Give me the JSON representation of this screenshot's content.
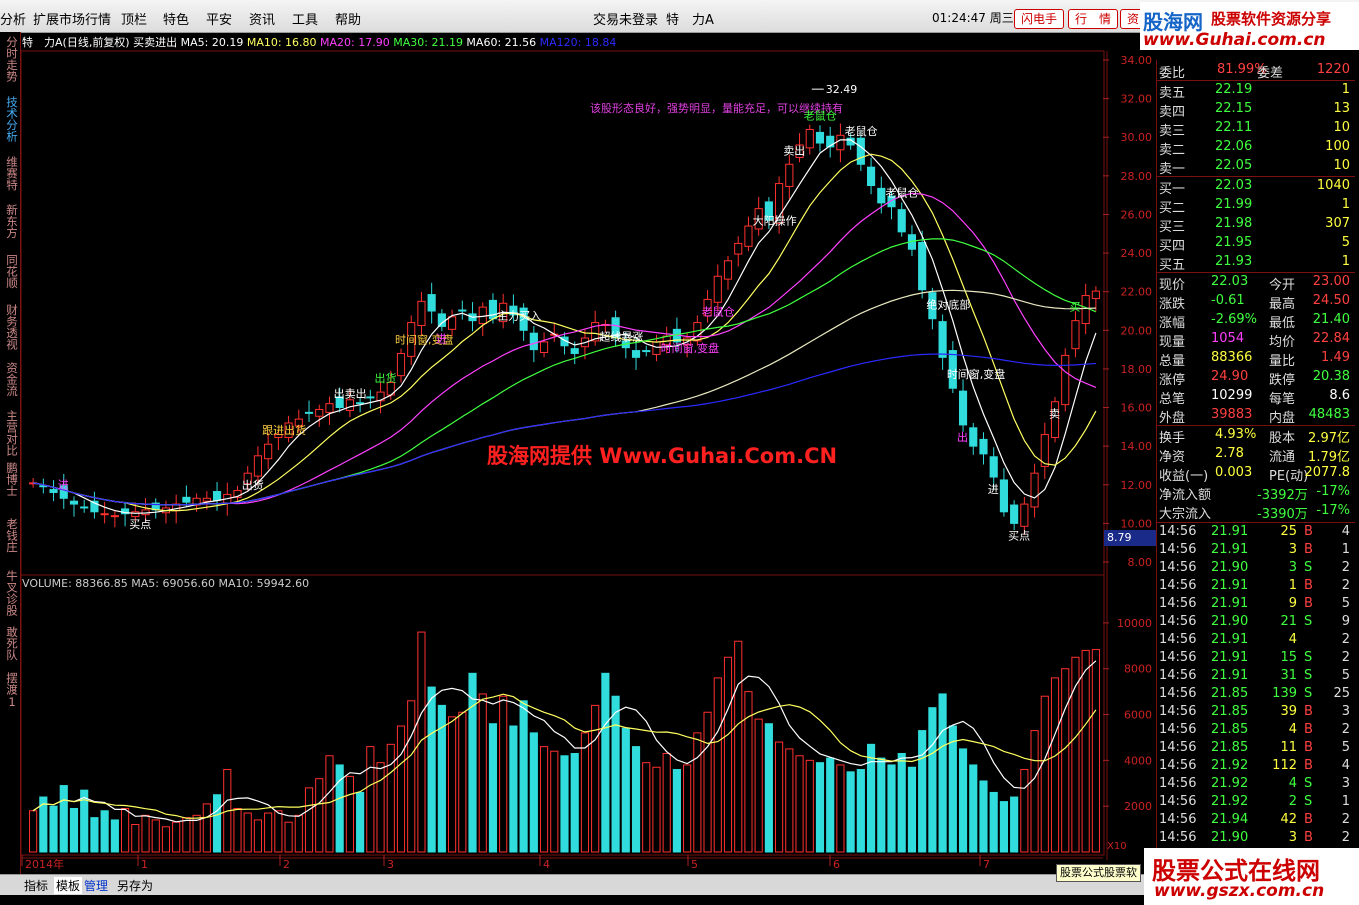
{
  "menubar": {
    "items": [
      "分析",
      "扩展市场行情",
      "资讯",
      "特色",
      "平安",
      "资讯",
      "工具",
      "帮助"
    ],
    "left_items": [
      "分析",
      "扩展市场行情",
      "顶栏",
      "特色",
      "平安",
      "资讯",
      "工具",
      "帮助"
    ],
    "login_status": "交易未登录",
    "stock_short": "特　力A",
    "clock": "01:24:47 周三",
    "buttons": [
      "闪电手",
      "行　情",
      "资"
    ]
  },
  "logo_top": {
    "brand": "股海网",
    "slogan": "股票软件资源分享",
    "url": "www.Guhai.com.cn"
  },
  "sidebar": {
    "tabs": [
      "分时走势",
      "技术分析",
      "维赛特",
      "新东方",
      "同花顺",
      "财务透视",
      "资金流",
      "主营对比",
      "鹏博士",
      "老钱庄",
      "牛叉诊股",
      "敢死队",
      "摆渡1"
    ]
  },
  "price_panel": {
    "title": "特　力A(日线,前复权) 买卖进出",
    "indicators": [
      {
        "label": "MA5: 20.19",
        "color": "#ffffff"
      },
      {
        "label": "MA10: 16.80",
        "color": "#ffff60"
      },
      {
        "label": "MA20: 17.90",
        "color": "#ff40ff"
      },
      {
        "label": "MA30: 21.19",
        "color": "#40ff40"
      },
      {
        "label": "MA60: 21.56",
        "color": "#ffffff"
      },
      {
        "label": "MA120: 18.84",
        "color": "#2a2aff"
      }
    ],
    "y_ticks": [
      "34.00",
      "32.00",
      "30.00",
      "28.00",
      "26.00",
      "24.00",
      "22.00",
      "20.00",
      "18.00",
      "16.00",
      "14.00",
      "12.00",
      "10.00",
      "8.00"
    ],
    "price_tag": "8.79",
    "max_label": "32.49"
  },
  "volume_panel": {
    "title": "VOLUME: 88366.85",
    "ma5": "MA5: 69056.60",
    "ma10": "MA10: 59942.60",
    "y_ticks": [
      "10000",
      "8000",
      "6000",
      "4000",
      "2000"
    ],
    "unit": "X10"
  },
  "time_axis": [
    "2014年",
    "1",
    "2",
    "3",
    "4",
    "5",
    "6",
    "7"
  ],
  "annotations": {
    "comment": "该股形态良好，强势明显，量能充足，可以继续持有",
    "watermark": "股海网提供 Www.Guhai.Com.CN",
    "marks": [
      "进",
      "买点",
      "出货",
      "跟进出货",
      "出卖出",
      "出货",
      "时间窗,变盘",
      "进",
      "主力买入",
      "超线暴涨",
      "时间窗,变盘",
      "老鼠仓",
      "大阳操作",
      "卖出",
      "老鼠仓",
      "老鼠仓",
      "老鼠仓",
      "绝对底部",
      "时间窗,变盘",
      "买点",
      "出",
      "进",
      "买",
      "卖"
    ]
  },
  "order_book": {
    "weibi_label": "委比",
    "weibi": "81.99%",
    "weicha_label": "委差",
    "weicha": "1220",
    "asks": [
      {
        "label": "卖五",
        "price": "22.19",
        "vol": "1"
      },
      {
        "label": "卖四",
        "price": "22.15",
        "vol": "13"
      },
      {
        "label": "卖三",
        "price": "22.11",
        "vol": "10"
      },
      {
        "label": "卖二",
        "price": "22.06",
        "vol": "100"
      },
      {
        "label": "卖一",
        "price": "22.05",
        "vol": "10"
      }
    ],
    "bids": [
      {
        "label": "买一",
        "price": "22.03",
        "vol": "1040"
      },
      {
        "label": "买二",
        "price": "21.99",
        "vol": "1"
      },
      {
        "label": "买三",
        "price": "21.98",
        "vol": "307"
      },
      {
        "label": "买四",
        "price": "21.95",
        "vol": "5"
      },
      {
        "label": "买五",
        "price": "21.93",
        "vol": "1"
      }
    ]
  },
  "quote": [
    {
      "l1": "现价",
      "v1": "22.03",
      "c1": "#40ff40",
      "l2": "今开",
      "v2": "23.00",
      "c2": "#ff4040"
    },
    {
      "l1": "涨跌",
      "v1": "-0.61",
      "c1": "#40ff40",
      "l2": "最高",
      "v2": "24.50",
      "c2": "#ff4040"
    },
    {
      "l1": "涨幅",
      "v1": "-2.69%",
      "c1": "#40ff40",
      "l2": "最低",
      "v2": "21.40",
      "c2": "#40ff40"
    },
    {
      "l1": "现量",
      "v1": "1054",
      "c1": "#ff40ff",
      "l2": "均价",
      "v2": "22.84",
      "c2": "#ff4040"
    },
    {
      "l1": "总量",
      "v1": "88366",
      "c1": "#ffff40",
      "l2": "量比",
      "v2": "1.49",
      "c2": "#ff4040"
    },
    {
      "l1": "涨停",
      "v1": "24.90",
      "c1": "#ff4040",
      "l2": "跌停",
      "v2": "20.38",
      "c2": "#40ff40"
    },
    {
      "l1": "总笔",
      "v1": "10299",
      "c1": "#ffffff",
      "l2": "每笔",
      "v2": "8.6",
      "c2": "#ffffff"
    },
    {
      "l1": "外盘",
      "v1": "39883",
      "c1": "#ff4040",
      "l2": "内盘",
      "v2": "48483",
      "c2": "#40ff40"
    }
  ],
  "finance": [
    {
      "l1": "换手",
      "v1": "4.93%",
      "l2": "股本",
      "v2": "2.97亿"
    },
    {
      "l1": "净资",
      "v1": "2.78",
      "l2": "流通",
      "v2": "1.79亿"
    },
    {
      "l1": "收益(一)",
      "v1": "0.003",
      "l2": "PE(动)",
      "v2": "2077.8"
    }
  ],
  "flows": [
    {
      "label": "净流入额",
      "value": "-3392万",
      "pct": "-17%"
    },
    {
      "label": "大宗流入",
      "value": "-3390万",
      "pct": "-17%"
    }
  ],
  "ticks": [
    {
      "t": "14:56",
      "p": "21.91",
      "v": "25",
      "s": "B",
      "n": "4"
    },
    {
      "t": "14:56",
      "p": "21.91",
      "v": "3",
      "s": "B",
      "n": "1"
    },
    {
      "t": "14:56",
      "p": "21.90",
      "v": "3",
      "s": "S",
      "n": "2"
    },
    {
      "t": "14:56",
      "p": "21.91",
      "v": "1",
      "s": "B",
      "n": "2"
    },
    {
      "t": "14:56",
      "p": "21.91",
      "v": "9",
      "s": "B",
      "n": "5"
    },
    {
      "t": "14:56",
      "p": "21.90",
      "v": "21",
      "s": "S",
      "n": "9"
    },
    {
      "t": "14:56",
      "p": "21.91",
      "v": "4",
      "s": "",
      "n": "2"
    },
    {
      "t": "14:56",
      "p": "21.91",
      "v": "15",
      "s": "S",
      "n": "2"
    },
    {
      "t": "14:56",
      "p": "21.91",
      "v": "31",
      "s": "S",
      "n": "5"
    },
    {
      "t": "14:56",
      "p": "21.85",
      "v": "139",
      "s": "S",
      "n": "25"
    },
    {
      "t": "14:56",
      "p": "21.85",
      "v": "39",
      "s": "B",
      "n": "3"
    },
    {
      "t": "14:56",
      "p": "21.85",
      "v": "4",
      "s": "B",
      "n": "2"
    },
    {
      "t": "14:56",
      "p": "21.85",
      "v": "11",
      "s": "B",
      "n": "5"
    },
    {
      "t": "14:56",
      "p": "21.92",
      "v": "112",
      "s": "B",
      "n": "4"
    },
    {
      "t": "14:56",
      "p": "21.92",
      "v": "4",
      "s": "S",
      "n": "3"
    },
    {
      "t": "14:56",
      "p": "21.92",
      "v": "2",
      "s": "S",
      "n": "1"
    },
    {
      "t": "14:56",
      "p": "21.94",
      "v": "42",
      "s": "B",
      "n": "2"
    },
    {
      "t": "14:56",
      "p": "21.90",
      "v": "3",
      "s": "B",
      "n": "2"
    }
  ],
  "bottom_tabs": [
    "指标",
    "模板",
    "管理",
    "另存为"
  ],
  "formula_tag": "股票公式股票软",
  "logo_bottom": {
    "brand": "股票公式在线网",
    "url": "www.gszx.com.cn"
  },
  "chart_data": [
    {
      "type": "candlestick",
      "title": "特　力A(日线,前复权) 买卖进出",
      "ylim": [
        8,
        34
      ],
      "x_ticks": [
        "2014年",
        "1",
        "2",
        "3",
        "4",
        "5",
        "6",
        "7"
      ],
      "close": [
        12.1,
        11.9,
        11.6,
        11.3,
        11.0,
        10.8,
        10.6,
        10.5,
        10.4,
        10.5,
        10.6,
        10.7,
        10.7,
        10.8,
        11.0,
        11.1,
        11.3,
        11.3,
        11.2,
        11.5,
        11.7,
        12.6,
        13.5,
        14.1,
        14.6,
        15.2,
        15.4,
        15.7,
        15.9,
        16.2,
        16.0,
        16.4,
        16.2,
        16.5,
        16.8,
        17.3,
        18.8,
        20.4,
        21.5,
        21.0,
        20.2,
        20.7,
        21.0,
        20.5,
        21.2,
        20.6,
        21.4,
        20.8,
        20.0,
        19.0,
        19.4,
        19.8,
        19.2,
        18.8,
        19.6,
        20.4,
        20.3,
        19.6,
        19.1,
        18.6,
        18.9,
        19.4,
        19.7,
        19.4,
        19.6,
        20.4,
        21.6,
        22.8,
        23.6,
        24.5,
        25.4,
        26.3,
        25.7,
        27.6,
        28.6,
        29.6,
        30.4,
        29.7,
        29.5,
        30.1,
        29.6,
        28.6,
        27.5,
        26.6,
        26.4,
        25.1,
        24.2,
        22.1,
        20.6,
        18.6,
        17.0,
        15.1,
        14.0,
        13.6,
        12.4,
        10.6,
        10.0,
        11.0,
        12.6,
        14.6,
        16.3,
        18.7,
        20.5,
        21.8,
        22.03
      ],
      "ma5_last": 20.19,
      "ma10_last": 16.8,
      "ma20_last": 17.9,
      "ma30_last": 21.19,
      "ma60_last": 21.56,
      "ma120_last": 18.84,
      "max_label": 32.49,
      "last_price": 22.03,
      "price_tag": 8.79
    },
    {
      "type": "bar",
      "title": "VOLUME",
      "ylim": [
        0,
        11000
      ],
      "volume_last": 88366.85,
      "ma5_last": 69056.6,
      "ma10_last": 59942.6,
      "values": [
        1800,
        2400,
        2000,
        2900,
        1900,
        2700,
        1500,
        1800,
        1400,
        1900,
        1200,
        1600,
        1400,
        1100,
        1300,
        1500,
        1600,
        2100,
        2500,
        3600,
        1900,
        1700,
        1400,
        1700,
        1800,
        1300,
        1600,
        2800,
        3200,
        4200,
        3800,
        3300,
        2600,
        4600,
        3900,
        4700,
        5500,
        6600,
        9600,
        7200,
        6400,
        5900,
        6100,
        7800,
        6900,
        5600,
        6800,
        5500,
        6600,
        5200,
        4600,
        4400,
        4200,
        4300,
        5200,
        6400,
        7800,
        6800,
        5400,
        4600,
        3900,
        3700,
        4300,
        3600,
        3800,
        5200,
        6100,
        7600,
        8500,
        9200,
        7000,
        5800,
        5600,
        4800,
        4500,
        4200,
        4000,
        3900,
        4100,
        3800,
        3500,
        3600,
        4700,
        4100,
        3800,
        4300,
        3700,
        5300,
        6300,
        6900,
        5500,
        4500,
        3800,
        3100,
        2600,
        2200,
        2400,
        3600,
        5300,
        6800,
        7600,
        8000,
        8500,
        8800,
        8836
      ]
    }
  ]
}
